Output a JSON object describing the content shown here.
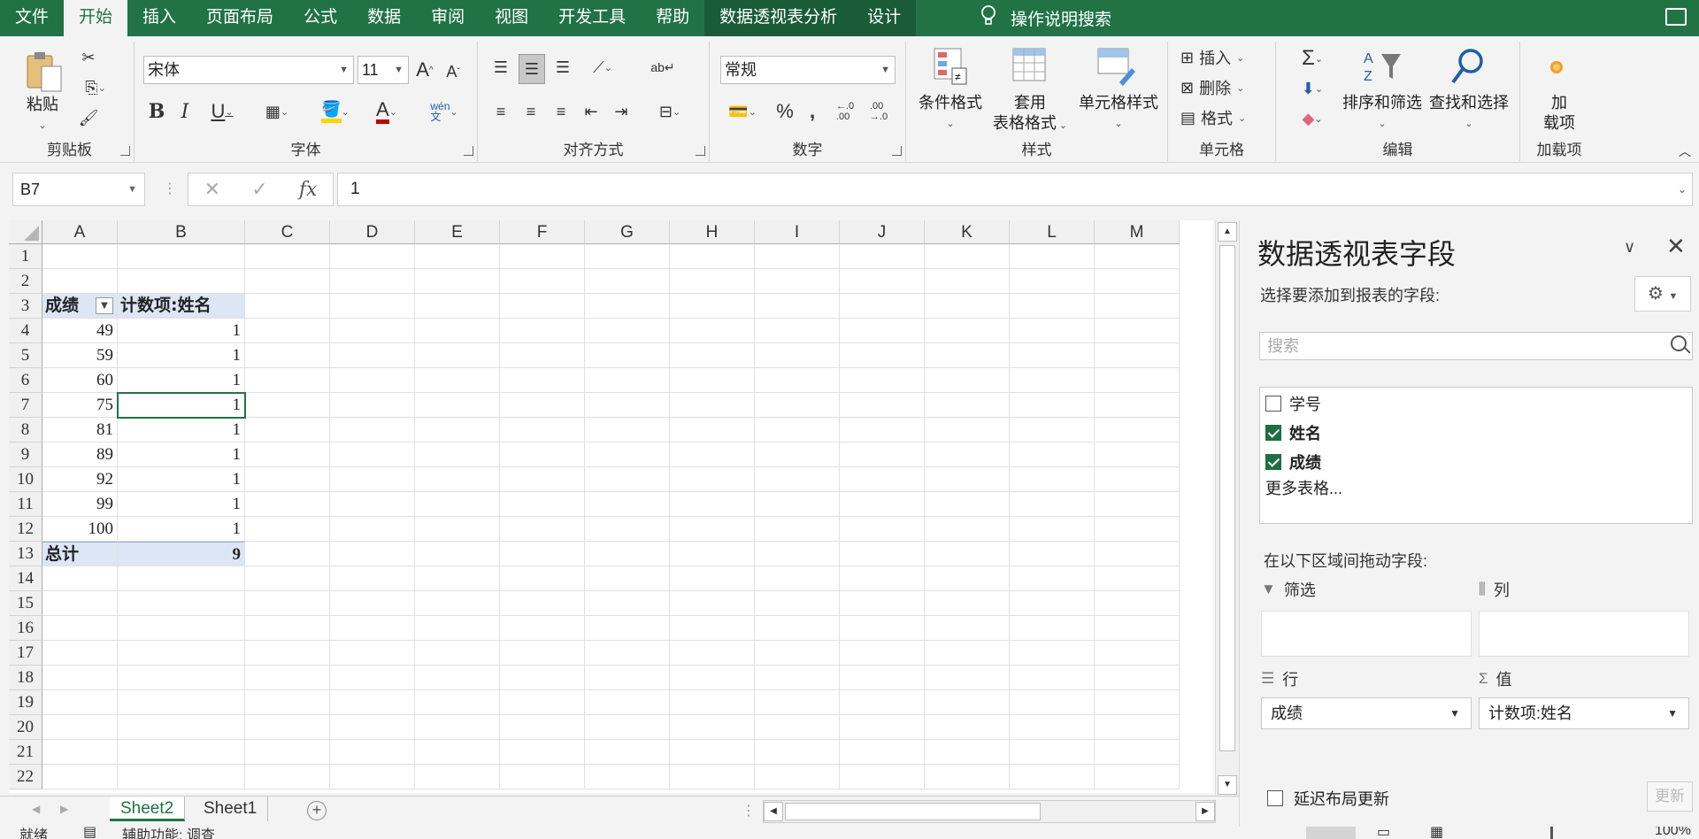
{
  "tabs": [
    {
      "label": "文件",
      "active": false,
      "ctx": false
    },
    {
      "label": "开始",
      "active": true,
      "ctx": false
    },
    {
      "label": "插入",
      "active": false,
      "ctx": false
    },
    {
      "label": "页面布局",
      "active": false,
      "ctx": false
    },
    {
      "label": "公式",
      "active": false,
      "ctx": false
    },
    {
      "label": "数据",
      "active": false,
      "ctx": false
    },
    {
      "label": "审阅",
      "active": false,
      "ctx": false
    },
    {
      "label": "视图",
      "active": false,
      "ctx": false
    },
    {
      "label": "开发工具",
      "active": false,
      "ctx": false
    },
    {
      "label": "帮助",
      "active": false,
      "ctx": false
    },
    {
      "label": "数据透视表分析",
      "active": false,
      "ctx": true
    },
    {
      "label": "设计",
      "active": false,
      "ctx": true
    }
  ],
  "tellme": "操作说明搜索",
  "ribbon": {
    "clipboard": {
      "paste": "粘贴",
      "group": "剪贴板"
    },
    "font": {
      "name": "宋体",
      "size": "11",
      "group": "字体",
      "phonetic": "wén"
    },
    "alignment": {
      "group": "对齐方式"
    },
    "number": {
      "format": "常规",
      "group": "数字"
    },
    "styles": {
      "conditional": "条件格式",
      "table_line1": "套用",
      "table_line2": "表格格式",
      "cell_styles": "单元格样式",
      "group": "样式"
    },
    "cells": {
      "insert": "插入",
      "delete": "删除",
      "format": "格式",
      "group": "单元格"
    },
    "editing": {
      "sort": "排序和筛选",
      "find": "查找和选择",
      "group": "编辑"
    },
    "addins": {
      "line1": "加",
      "line2": "载项",
      "group": "加载项"
    }
  },
  "formula_bar": {
    "name_box": "B7",
    "fx": "fx",
    "value": "1"
  },
  "grid": {
    "columns": [
      "A",
      "B",
      "C",
      "D",
      "E",
      "F",
      "G",
      "H",
      "I",
      "J",
      "K",
      "L",
      "M"
    ],
    "rows": [
      "1",
      "2",
      "3",
      "4",
      "5",
      "6",
      "7",
      "8",
      "9",
      "10",
      "11",
      "12",
      "13",
      "14",
      "15",
      "16",
      "17",
      "18",
      "19",
      "20",
      "21",
      "22"
    ],
    "pivot_header": {
      "a": "成绩",
      "b": "计数项:姓名"
    },
    "pivot_rows": [
      {
        "a": "49",
        "b": "1"
      },
      {
        "a": "59",
        "b": "1"
      },
      {
        "a": "60",
        "b": "1"
      },
      {
        "a": "75",
        "b": "1"
      },
      {
        "a": "81",
        "b": "1"
      },
      {
        "a": "89",
        "b": "1"
      },
      {
        "a": "92",
        "b": "1"
      },
      {
        "a": "99",
        "b": "1"
      },
      {
        "a": "100",
        "b": "1"
      }
    ],
    "pivot_total": {
      "a": "总计",
      "b": "9"
    }
  },
  "sheets": [
    {
      "label": "Sheet2",
      "active": true
    },
    {
      "label": "Sheet1",
      "active": false
    }
  ],
  "statusbar": {
    "ready": "就绪",
    "accessibility": "辅助功能: 调查",
    "zoom": "100%"
  },
  "pivot_pane": {
    "title": "数据透视表字段",
    "subtitle": "选择要添加到报表的字段:",
    "search_placeholder": "搜索",
    "fields": [
      {
        "label": "学号",
        "checked": false
      },
      {
        "label": "姓名",
        "checked": true
      },
      {
        "label": "成绩",
        "checked": true
      }
    ],
    "more_tables": "更多表格...",
    "drag_label": "在以下区域间拖动字段:",
    "areas": {
      "filter": {
        "label": "筛选"
      },
      "columns": {
        "label": "列"
      },
      "rows": {
        "label": "行",
        "item": "成绩"
      },
      "values": {
        "label": "值",
        "item": "计数项:姓名"
      }
    },
    "defer_label": "延迟布局更新",
    "update_label": "更新"
  },
  "colors": {
    "accent": "#217346",
    "pivot_header": "#dce6f5"
  }
}
